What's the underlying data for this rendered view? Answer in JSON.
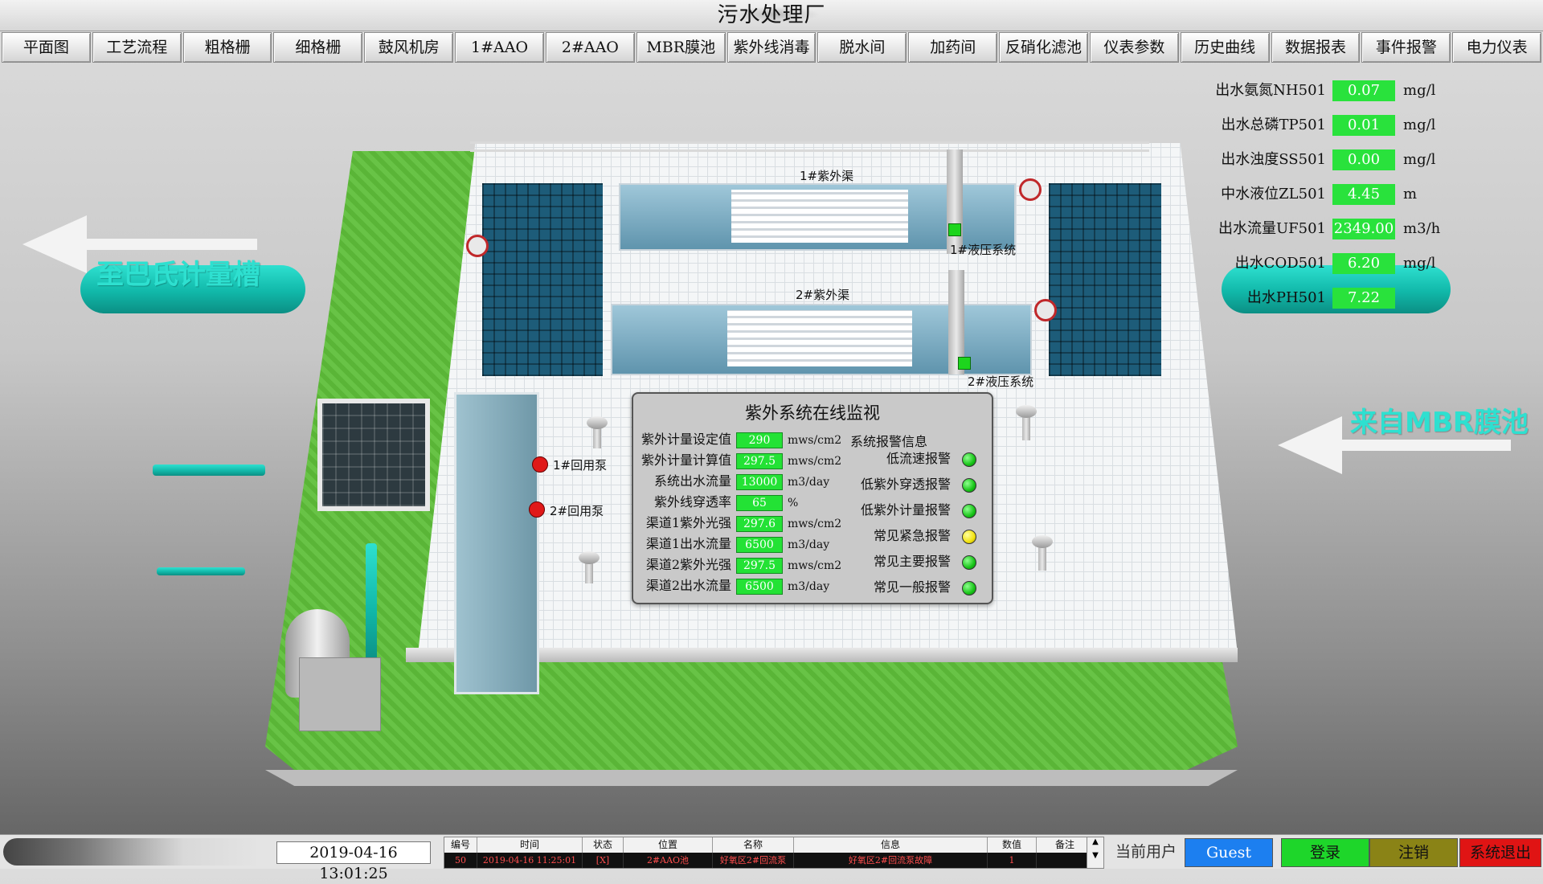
{
  "window": {
    "title": "污水处理厂"
  },
  "nav": [
    "平面图",
    "工艺流程",
    "粗格栅",
    "细格栅",
    "鼓风机房",
    "1#AAO",
    "2#AAO",
    "MBR膜池",
    "紫外线消毒",
    "脱水间",
    "加药间",
    "反硝化滤池",
    "仪表参数",
    "历史曲线",
    "数据报表",
    "事件报警",
    "电力仪表"
  ],
  "scene": {
    "to_label": "至巴氏计量槽",
    "from_label": "来自MBR膜池",
    "channel1": "1#紫外渠",
    "channel2": "2#紫外渠",
    "hydraulic1": "1#液压系统",
    "hydraulic2": "2#液压系统",
    "pump1": "1#回用泵",
    "pump2": "2#回用泵",
    "colors": {
      "pipe": "#11b8a9",
      "grass": "#5fbf3a",
      "ok": "#17c417",
      "warn": "#f2e20f",
      "fault": "#e01919"
    }
  },
  "readouts": [
    {
      "label": "出水氨氮NH501",
      "value": "0.07",
      "unit": "mg/l"
    },
    {
      "label": "出水总磷TP501",
      "value": "0.01",
      "unit": "mg/l"
    },
    {
      "label": "出水浊度SS501",
      "value": "0.00",
      "unit": "mg/l"
    },
    {
      "label": "中水液位ZL501",
      "value": "4.45",
      "unit": "m"
    },
    {
      "label": "出水流量UF501",
      "value": "2349.00",
      "unit": "m3/h"
    },
    {
      "label": "出水COD501",
      "value": "6.20",
      "unit": "mg/l"
    },
    {
      "label": "出水PH501",
      "value": "7.22",
      "unit": ""
    }
  ],
  "uv_panel": {
    "title": "紫外系统在线监视",
    "params": [
      {
        "label": "紫外计量设定值",
        "value": "290",
        "unit": "mws/cm2"
      },
      {
        "label": "紫外计量计算值",
        "value": "297.5",
        "unit": "mws/cm2"
      },
      {
        "label": "系统出水流量",
        "value": "13000",
        "unit": "m3/day"
      },
      {
        "label": "紫外线穿透率",
        "value": "65",
        "unit": "%"
      },
      {
        "label": "渠道1紫外光强",
        "value": "297.6",
        "unit": "mws/cm2"
      },
      {
        "label": "渠道1出水流量",
        "value": "6500",
        "unit": "m3/day"
      },
      {
        "label": "渠道2紫外光强",
        "value": "297.5",
        "unit": "mws/cm2"
      },
      {
        "label": "渠道2出水流量",
        "value": "6500",
        "unit": "m3/day"
      }
    ],
    "alarm_header": "系统报警信息",
    "alarms": [
      {
        "label": "低流速报警",
        "state": "green"
      },
      {
        "label": "低紫外穿透报警",
        "state": "green"
      },
      {
        "label": "低紫外计量报警",
        "state": "green"
      },
      {
        "label": "常见紧急报警",
        "state": "yellow"
      },
      {
        "label": "常见主要报警",
        "state": "green"
      },
      {
        "label": "常见一般报警",
        "state": "green"
      }
    ]
  },
  "bottom": {
    "datetime": "2019-04-16 13:01:25",
    "event_headers": [
      "编号",
      "时间",
      "状态",
      "位置",
      "名称",
      "信息",
      "数值",
      "备注"
    ],
    "event_row": [
      "50",
      "2019-04-16 11:25:01",
      "[X]",
      "2#AAO池",
      "好氧区2#回流泵",
      "好氧区2#回流泵故障",
      "1",
      ""
    ],
    "current_user_label": "当前用户",
    "user": "Guest",
    "login": "登录",
    "logout": "注销",
    "exit": "系统退出"
  }
}
